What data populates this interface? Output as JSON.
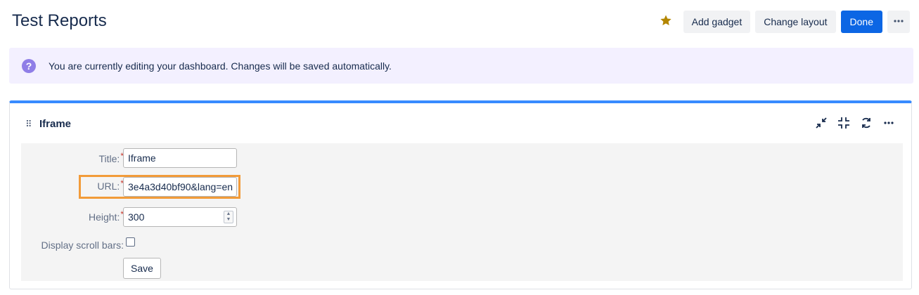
{
  "header": {
    "title": "Test Reports",
    "star_icon": "star-icon",
    "star_color": "#b38600",
    "add_gadget_label": "Add gadget",
    "change_layout_label": "Change layout",
    "done_label": "Done",
    "more_icon": "more-horizontal-icon"
  },
  "banner": {
    "icon": "question-circle-icon",
    "icon_glyph": "?",
    "text": "You are currently editing your dashboard. Changes will be saved automatically."
  },
  "gadget": {
    "title": "Iframe",
    "accent_color": "#388bff",
    "drag_handle_glyph": "⠿",
    "actions": [
      "minimize-icon",
      "collapse-icon",
      "refresh-icon",
      "more-horizontal-icon"
    ],
    "form": {
      "title_label": "Title:",
      "title_value": "Iframe",
      "url_label": "URL:",
      "url_value": "3e4a3d40bf90&lang=en",
      "height_label": "Height:",
      "height_value": "300",
      "scrollbars_label": "Display scroll bars:",
      "scrollbars_checked": false,
      "required_marker": "*",
      "save_label": "Save"
    },
    "highlight_color": "#f29b39"
  }
}
